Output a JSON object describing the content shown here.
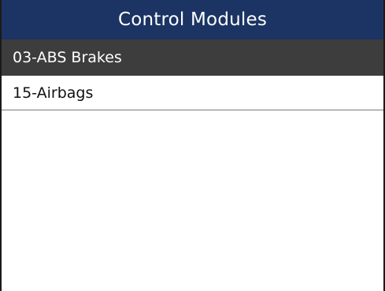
{
  "header": {
    "title": "Control Modules"
  },
  "modules": {
    "selected_index": 0,
    "items": [
      {
        "label": "03-ABS Brakes"
      },
      {
        "label": "15-Airbags"
      }
    ]
  },
  "colors": {
    "header_bg": "#1b3463",
    "selected_bg": "#3d3d3d",
    "text": "#111111",
    "background": "#ffffff"
  }
}
